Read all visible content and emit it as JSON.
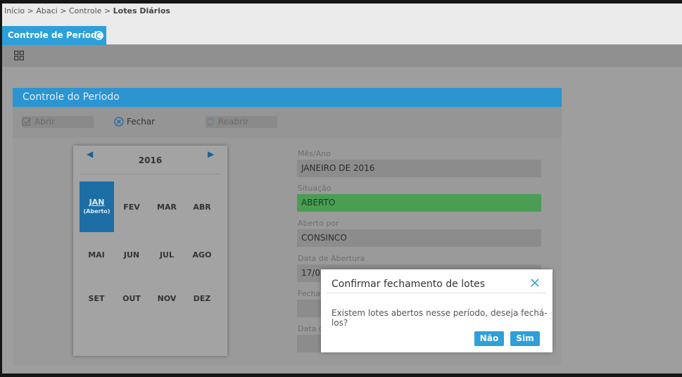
{
  "breadcrumb": {
    "items": [
      "Início",
      "Abaci",
      "Controle"
    ],
    "separator": ">",
    "current": "Lotes Diários"
  },
  "tab": {
    "label": "Controle de Período",
    "close_icon": "close-circle-icon"
  },
  "toolbar": {
    "icon": "grid-icon"
  },
  "panel": {
    "title": "Controle do Período"
  },
  "actions": {
    "abrir": {
      "label": "Abrir",
      "icon": "check-square-icon",
      "enabled": false
    },
    "fechar": {
      "label": "Fechar",
      "icon": "close-circle-icon",
      "enabled": true
    },
    "reabrir": {
      "label": "Reabrir",
      "icon": "refresh-icon",
      "enabled": false
    }
  },
  "calendar": {
    "year": "2016",
    "prev_icon": "triangle-left-icon",
    "next_icon": "triangle-right-icon",
    "months": [
      "JAN",
      "FEV",
      "MAR",
      "ABR",
      "MAI",
      "JUN",
      "JUL",
      "AGO",
      "SET",
      "OUT",
      "NOV",
      "DEZ"
    ],
    "selected_month": "JAN",
    "selected_status": "(Aberto)"
  },
  "fields": {
    "mes_ano": {
      "label": "Mês/Ano",
      "value": "JANEIRO DE 2016"
    },
    "situacao": {
      "label": "Situação",
      "value": "ABERTO"
    },
    "aberto_por": {
      "label": "Aberto por",
      "value": "CONSINCO"
    },
    "data_abertura": {
      "label": "Data de Abertura",
      "value": "17/0"
    },
    "fechado_por": {
      "label": "Fecha",
      "value": ""
    },
    "data_fechamento": {
      "label": "Data d",
      "value": ""
    }
  },
  "dialog": {
    "title": "Confirmar fechamento de lotes",
    "message": "Existem lotes abertos nesse período, deseja fechá-los?",
    "no_label": "Não",
    "yes_label": "Sim"
  },
  "colors": {
    "accent": "#2d9fd9",
    "status_open": "#4a9e54",
    "selected_month": "#1e6ea6"
  }
}
